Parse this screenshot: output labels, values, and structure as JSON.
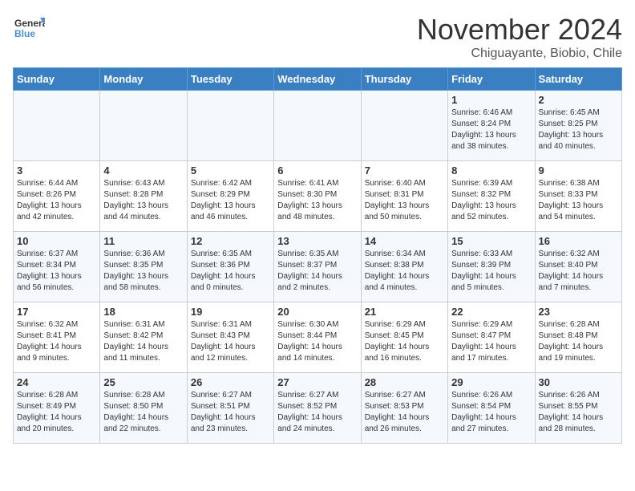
{
  "logo": {
    "line1": "General",
    "line2": "Blue"
  },
  "title": "November 2024",
  "subtitle": "Chiguayante, Biobio, Chile",
  "days_of_week": [
    "Sunday",
    "Monday",
    "Tuesday",
    "Wednesday",
    "Thursday",
    "Friday",
    "Saturday"
  ],
  "weeks": [
    [
      {
        "day": "",
        "info": ""
      },
      {
        "day": "",
        "info": ""
      },
      {
        "day": "",
        "info": ""
      },
      {
        "day": "",
        "info": ""
      },
      {
        "day": "",
        "info": ""
      },
      {
        "day": "1",
        "info": "Sunrise: 6:46 AM\nSunset: 8:24 PM\nDaylight: 13 hours\nand 38 minutes."
      },
      {
        "day": "2",
        "info": "Sunrise: 6:45 AM\nSunset: 8:25 PM\nDaylight: 13 hours\nand 40 minutes."
      }
    ],
    [
      {
        "day": "3",
        "info": "Sunrise: 6:44 AM\nSunset: 8:26 PM\nDaylight: 13 hours\nand 42 minutes."
      },
      {
        "day": "4",
        "info": "Sunrise: 6:43 AM\nSunset: 8:28 PM\nDaylight: 13 hours\nand 44 minutes."
      },
      {
        "day": "5",
        "info": "Sunrise: 6:42 AM\nSunset: 8:29 PM\nDaylight: 13 hours\nand 46 minutes."
      },
      {
        "day": "6",
        "info": "Sunrise: 6:41 AM\nSunset: 8:30 PM\nDaylight: 13 hours\nand 48 minutes."
      },
      {
        "day": "7",
        "info": "Sunrise: 6:40 AM\nSunset: 8:31 PM\nDaylight: 13 hours\nand 50 minutes."
      },
      {
        "day": "8",
        "info": "Sunrise: 6:39 AM\nSunset: 8:32 PM\nDaylight: 13 hours\nand 52 minutes."
      },
      {
        "day": "9",
        "info": "Sunrise: 6:38 AM\nSunset: 8:33 PM\nDaylight: 13 hours\nand 54 minutes."
      }
    ],
    [
      {
        "day": "10",
        "info": "Sunrise: 6:37 AM\nSunset: 8:34 PM\nDaylight: 13 hours\nand 56 minutes."
      },
      {
        "day": "11",
        "info": "Sunrise: 6:36 AM\nSunset: 8:35 PM\nDaylight: 13 hours\nand 58 minutes."
      },
      {
        "day": "12",
        "info": "Sunrise: 6:35 AM\nSunset: 8:36 PM\nDaylight: 14 hours\nand 0 minutes."
      },
      {
        "day": "13",
        "info": "Sunrise: 6:35 AM\nSunset: 8:37 PM\nDaylight: 14 hours\nand 2 minutes."
      },
      {
        "day": "14",
        "info": "Sunrise: 6:34 AM\nSunset: 8:38 PM\nDaylight: 14 hours\nand 4 minutes."
      },
      {
        "day": "15",
        "info": "Sunrise: 6:33 AM\nSunset: 8:39 PM\nDaylight: 14 hours\nand 5 minutes."
      },
      {
        "day": "16",
        "info": "Sunrise: 6:32 AM\nSunset: 8:40 PM\nDaylight: 14 hours\nand 7 minutes."
      }
    ],
    [
      {
        "day": "17",
        "info": "Sunrise: 6:32 AM\nSunset: 8:41 PM\nDaylight: 14 hours\nand 9 minutes."
      },
      {
        "day": "18",
        "info": "Sunrise: 6:31 AM\nSunset: 8:42 PM\nDaylight: 14 hours\nand 11 minutes."
      },
      {
        "day": "19",
        "info": "Sunrise: 6:31 AM\nSunset: 8:43 PM\nDaylight: 14 hours\nand 12 minutes."
      },
      {
        "day": "20",
        "info": "Sunrise: 6:30 AM\nSunset: 8:44 PM\nDaylight: 14 hours\nand 14 minutes."
      },
      {
        "day": "21",
        "info": "Sunrise: 6:29 AM\nSunset: 8:45 PM\nDaylight: 14 hours\nand 16 minutes."
      },
      {
        "day": "22",
        "info": "Sunrise: 6:29 AM\nSunset: 8:47 PM\nDaylight: 14 hours\nand 17 minutes."
      },
      {
        "day": "23",
        "info": "Sunrise: 6:28 AM\nSunset: 8:48 PM\nDaylight: 14 hours\nand 19 minutes."
      }
    ],
    [
      {
        "day": "24",
        "info": "Sunrise: 6:28 AM\nSunset: 8:49 PM\nDaylight: 14 hours\nand 20 minutes."
      },
      {
        "day": "25",
        "info": "Sunrise: 6:28 AM\nSunset: 8:50 PM\nDaylight: 14 hours\nand 22 minutes."
      },
      {
        "day": "26",
        "info": "Sunrise: 6:27 AM\nSunset: 8:51 PM\nDaylight: 14 hours\nand 23 minutes."
      },
      {
        "day": "27",
        "info": "Sunrise: 6:27 AM\nSunset: 8:52 PM\nDaylight: 14 hours\nand 24 minutes."
      },
      {
        "day": "28",
        "info": "Sunrise: 6:27 AM\nSunset: 8:53 PM\nDaylight: 14 hours\nand 26 minutes."
      },
      {
        "day": "29",
        "info": "Sunrise: 6:26 AM\nSunset: 8:54 PM\nDaylight: 14 hours\nand 27 minutes."
      },
      {
        "day": "30",
        "info": "Sunrise: 6:26 AM\nSunset: 8:55 PM\nDaylight: 14 hours\nand 28 minutes."
      }
    ]
  ]
}
